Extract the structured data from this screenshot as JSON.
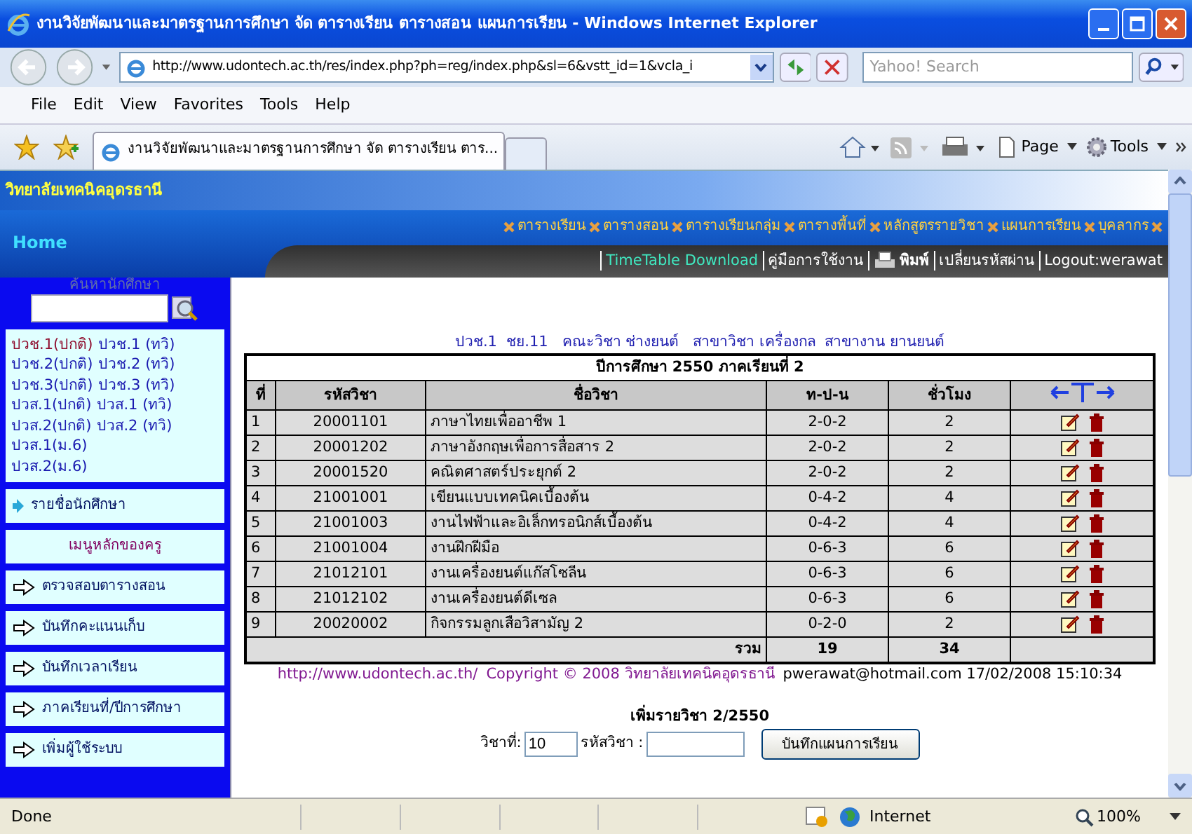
{
  "window": {
    "title": "งานวิจัยพัฒนาและมาตรฐานการศึกษา จัด ตารางเรียน ตารางสอน แผนการเรียน - Windows Internet Explorer"
  },
  "address_bar": {
    "url": "http://www.udontech.ac.th/res/index.php?ph=reg/index.php&sl=6&vstt_id=1&vcla_i"
  },
  "search": {
    "placeholder": "Yahoo! Search"
  },
  "menu": [
    "File",
    "Edit",
    "View",
    "Favorites",
    "Tools",
    "Help"
  ],
  "tabs": [
    {
      "label": "งานวิจัยพัฒนาและมาตรฐานการศึกษา จัด ตารางเรียน ตาร...",
      "selected": true
    }
  ],
  "command_bar": [
    "Page",
    "Tools"
  ],
  "site": {
    "title": "วิทยาลัยเทคนิคอุดรธานี",
    "home": "Home",
    "nav": [
      "ตารางเรียน",
      "ตารางสอน",
      "ตารางเรียนกลุ่ม",
      "ตารางพื้นที่",
      "หลักสูตรรายวิชา",
      "แผนการเรียน",
      "บุคลากร"
    ],
    "tools": [
      "TimeTable Download",
      "คู่มือการใช้งาน",
      "พิมพ์",
      "เปลี่ยนรหัสผ่าน",
      "Logout:werawat"
    ]
  },
  "sidebar": {
    "search_title": "ค้นหานักศึกษา",
    "levels": [
      [
        {
          "label": "ปวช.1(ปกติ)",
          "visited": true
        },
        {
          "label": "ปวช.1 (ทวิ)",
          "visited": false
        }
      ],
      [
        {
          "label": "ปวช.2(ปกติ)",
          "visited": false
        },
        {
          "label": "ปวช.2 (ทวิ)",
          "visited": false
        }
      ],
      [
        {
          "label": "ปวช.3(ปกติ)",
          "visited": false
        },
        {
          "label": "ปวช.3 (ทวิ)",
          "visited": false
        }
      ],
      [
        {
          "label": "ปวส.1(ปกติ)",
          "visited": false
        },
        {
          "label": "ปวส.1 (ทวิ)",
          "visited": false
        }
      ],
      [
        {
          "label": "ปวส.2(ปกติ)",
          "visited": false
        },
        {
          "label": "ปวส.2 (ทวิ)",
          "visited": false
        }
      ],
      [
        {
          "label": "ปวส.1(ม.6)",
          "visited": false
        }
      ],
      [
        {
          "label": "ปวส.2(ม.6)",
          "visited": false
        }
      ]
    ],
    "menu": [
      {
        "kind": "link",
        "label": "รายชื่อนักศึกษา"
      },
      {
        "kind": "heading",
        "label": "เมนูหลักของครู"
      },
      {
        "kind": "action",
        "label": "ตรวจสอบตารางสอน"
      },
      {
        "kind": "action",
        "label": "บันทึกคะแนนเก็บ"
      },
      {
        "kind": "action",
        "label": "บันทึกเวลาเรียน"
      },
      {
        "kind": "action",
        "label": "ภาคเรียนที่/ปีการศึกษา"
      },
      {
        "kind": "action",
        "label": "เพิ่มผู้ใช้ระบบ"
      }
    ]
  },
  "class_info": "ปวช.1  ชย.11   คณะวิชา ช่างยนต์   สาขาวิชา เครื่องกล  สาขางาน ยานยนต์",
  "table": {
    "caption": "ปีการศึกษา  2550  ภาคเรียนที่ 2",
    "columns": [
      "ที่",
      "รหัสวิชา",
      "ชื่อวิชา",
      "ท-ป-น",
      "ชั่วโมง"
    ],
    "rows": [
      {
        "no": "1",
        "code": "20001101",
        "name": "ภาษาไทยเพื่ออาชีพ 1",
        "tpn": "2-0-2",
        "hours": "2"
      },
      {
        "no": "2",
        "code": "20001202",
        "name": "ภาษาอังกฤษเพื่อการสื่อสาร 2",
        "tpn": "2-0-2",
        "hours": "2"
      },
      {
        "no": "3",
        "code": "20001520",
        "name": "คณิตศาสตร์ประยุกต์ 2",
        "tpn": "2-0-2",
        "hours": "2"
      },
      {
        "no": "4",
        "code": "21001001",
        "name": "เขียนแบบเทคนิคเบื้องต้น",
        "tpn": "0-4-2",
        "hours": "4"
      },
      {
        "no": "5",
        "code": "21001003",
        "name": "งานไฟฟ้าและอิเล็กทรอนิกส์เบื้องต้น",
        "tpn": "0-4-2",
        "hours": "4"
      },
      {
        "no": "6",
        "code": "21001004",
        "name": "งานฝึกฝีมือ",
        "tpn": "0-6-3",
        "hours": "6"
      },
      {
        "no": "7",
        "code": "21012101",
        "name": "งานเครื่องยนต์แก๊สโซลีน",
        "tpn": "0-6-3",
        "hours": "6"
      },
      {
        "no": "8",
        "code": "21012102",
        "name": "งานเครื่องยนต์ดีเซล",
        "tpn": "0-6-3",
        "hours": "6"
      },
      {
        "no": "9",
        "code": "20020002",
        "name": "กิจกรรมลูกเสือวิสามัญ 2",
        "tpn": "0-2-0",
        "hours": "2"
      }
    ],
    "total": {
      "label": "รวม",
      "column_4": "19",
      "column_5": "34"
    }
  },
  "footer": {
    "link": "http://www.udontech.ac.th/",
    "copyright": "Copyright © 2008  วิทยาลัยเทคนิคอุดรธานี",
    "contact": "pwerawat@hotmail.com 17/02/2008 15:10:34"
  },
  "form": {
    "title": "เพิ่มรายวิชา 2/2550",
    "number_label": "วิชาที่:",
    "number_value": "10",
    "code_label": "รหัสวิชา :",
    "submit": "บันทึกแผนการเรียน"
  },
  "status_bar": {
    "text": "Done",
    "zone": "Internet",
    "zoom": "100%"
  }
}
